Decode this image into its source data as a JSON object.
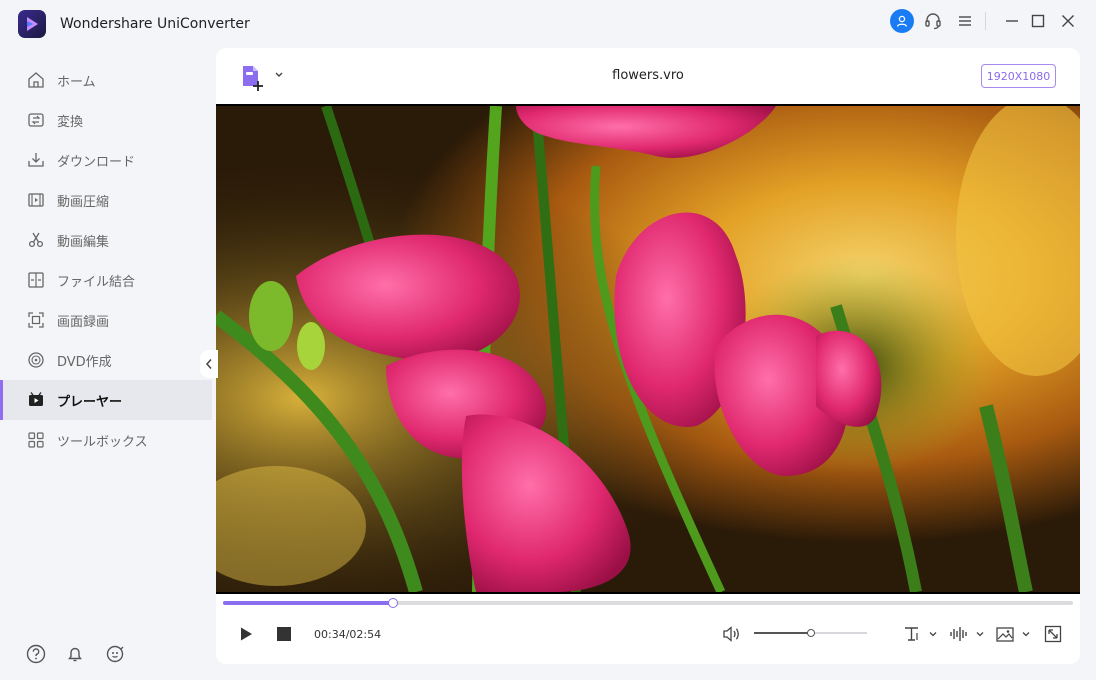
{
  "app": {
    "title": "Wondershare UniConverter"
  },
  "sidebar": {
    "items": [
      {
        "label": "ホーム",
        "icon": "home-icon"
      },
      {
        "label": "変換",
        "icon": "convert-icon"
      },
      {
        "label": "ダウンロード",
        "icon": "download-icon"
      },
      {
        "label": "動画圧縮",
        "icon": "compress-icon"
      },
      {
        "label": "動画編集",
        "icon": "scissors-icon"
      },
      {
        "label": "ファイル結合",
        "icon": "merge-icon"
      },
      {
        "label": "画面録画",
        "icon": "screen-record-icon"
      },
      {
        "label": "DVD作成",
        "icon": "dvd-icon"
      },
      {
        "label": "プレーヤー",
        "icon": "player-icon"
      },
      {
        "label": "ツールボックス",
        "icon": "toolbox-icon"
      }
    ],
    "active_index": 8
  },
  "player": {
    "file_name": "flowers.vro",
    "resolution": "1920X1080",
    "time": "00:34/02:54",
    "progress_fraction": 0.2,
    "volume_fraction": 0.5
  },
  "colors": {
    "accent": "#8b6df0",
    "user_button": "#1a7cf5",
    "sidebar_bg": "#f4f5f8"
  }
}
